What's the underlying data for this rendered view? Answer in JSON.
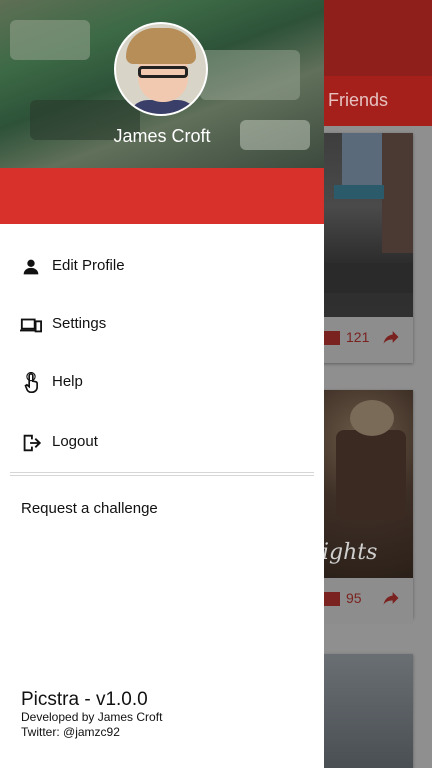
{
  "background_app": {
    "tab_label": "Friends",
    "cards": [
      {
        "count": "121"
      },
      {
        "count": "95"
      }
    ],
    "card2_overlay_text": "ights"
  },
  "drawer": {
    "user_name": "James Croft",
    "menu": [
      {
        "label": "Edit Profile",
        "icon": "person-icon"
      },
      {
        "label": "Settings",
        "icon": "devices-icon"
      },
      {
        "label": "Help",
        "icon": "touch-icon"
      },
      {
        "label": "Logout",
        "icon": "logout-icon"
      }
    ],
    "request_label": "Request a challenge",
    "footer": {
      "app_name": "Picstra - v1.0.0",
      "developed_by": "Developed by James Croft",
      "twitter": "Twitter: @jamzc92"
    }
  },
  "colors": {
    "accent": "#d8312c",
    "drawer_bg": "#ffffff"
  }
}
